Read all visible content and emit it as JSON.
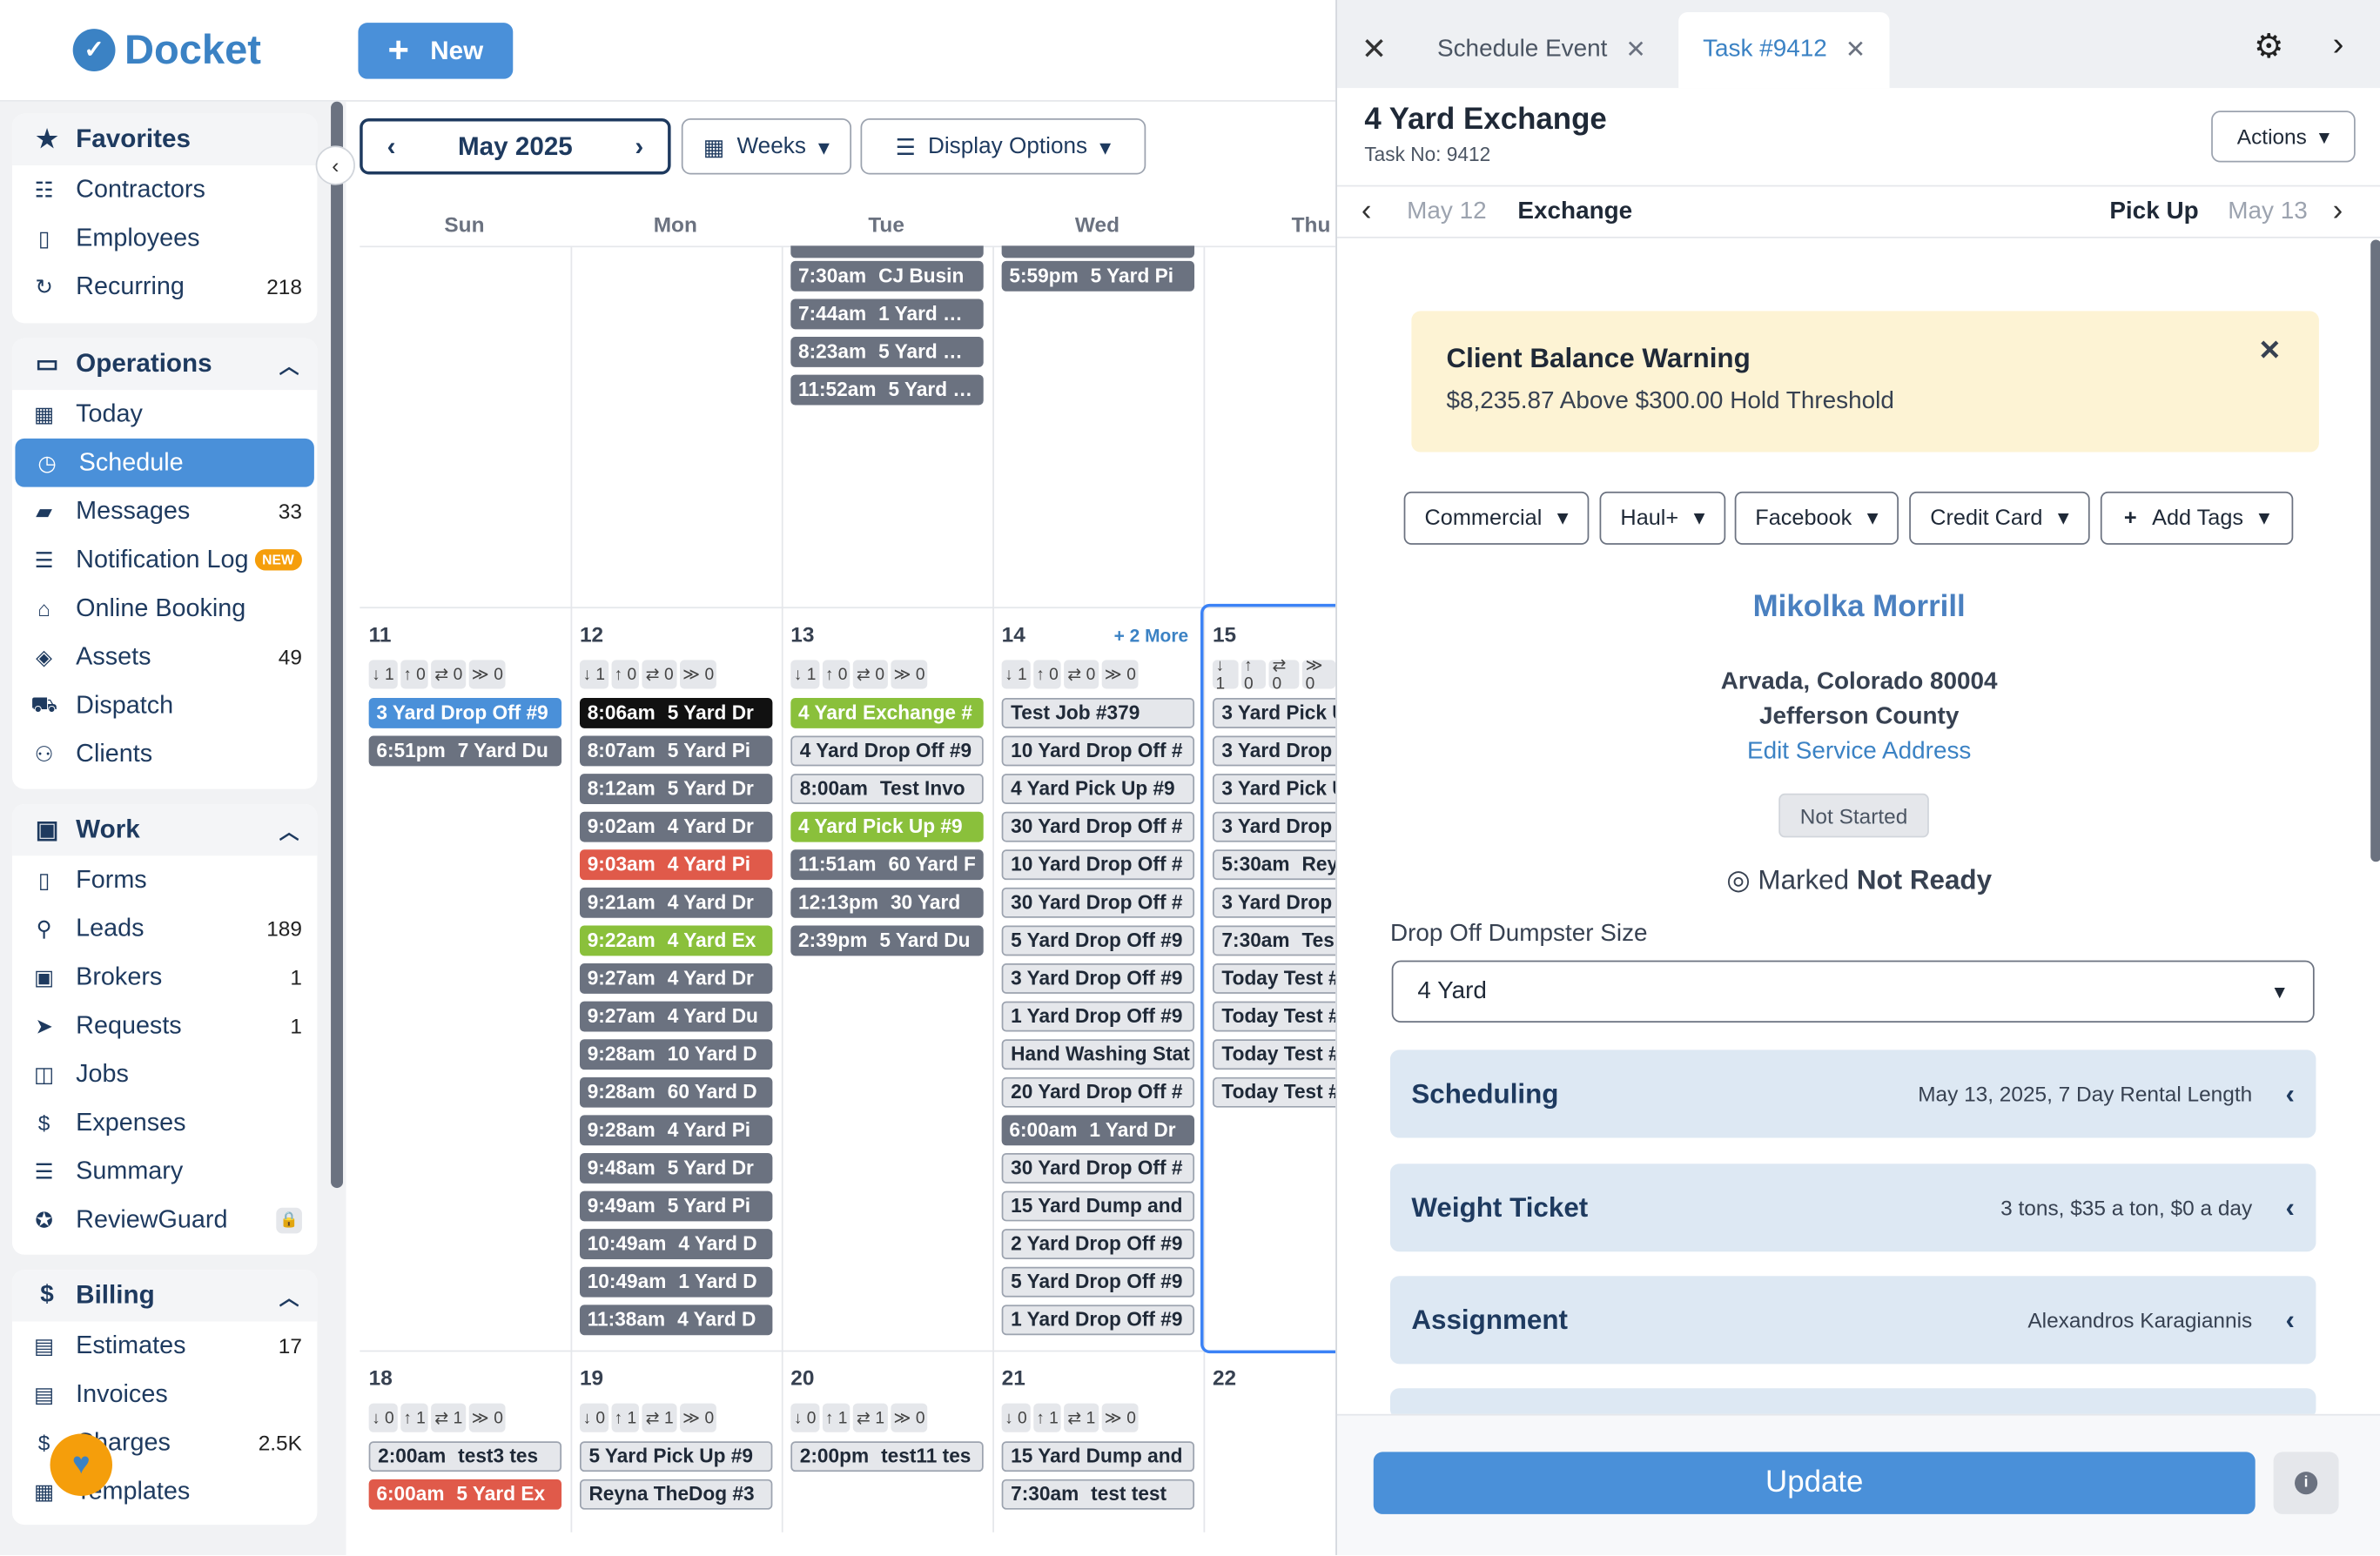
{
  "header": {
    "logo": "Docket",
    "new_label": "New"
  },
  "sidebar": {
    "favorites": {
      "title": "Favorites",
      "items": [
        {
          "label": "Contractors",
          "badge": ""
        },
        {
          "label": "Employees",
          "badge": ""
        },
        {
          "label": "Recurring",
          "badge": "218"
        }
      ]
    },
    "operations": {
      "title": "Operations",
      "items": [
        {
          "label": "Today",
          "badge": ""
        },
        {
          "label": "Schedule",
          "badge": ""
        },
        {
          "label": "Messages",
          "badge": "33"
        },
        {
          "label": "Notification Log",
          "badge": "NEW"
        },
        {
          "label": "Online Booking",
          "badge": ""
        },
        {
          "label": "Assets",
          "badge": "49"
        },
        {
          "label": "Dispatch",
          "badge": ""
        },
        {
          "label": "Clients",
          "badge": ""
        }
      ]
    },
    "work": {
      "title": "Work",
      "items": [
        {
          "label": "Forms",
          "badge": ""
        },
        {
          "label": "Leads",
          "badge": "189"
        },
        {
          "label": "Brokers",
          "badge": "1"
        },
        {
          "label": "Requests",
          "badge": "1"
        },
        {
          "label": "Jobs",
          "badge": ""
        },
        {
          "label": "Expenses",
          "badge": ""
        },
        {
          "label": "Summary",
          "badge": ""
        },
        {
          "label": "ReviewGuard",
          "badge": ""
        }
      ]
    },
    "billing": {
      "title": "Billing",
      "items": [
        {
          "label": "Estimates",
          "badge": "17"
        },
        {
          "label": "Invoices",
          "badge": ""
        },
        {
          "label": "Charges",
          "badge": "2.5K"
        },
        {
          "label": "Templates",
          "badge": ""
        }
      ]
    }
  },
  "calendar": {
    "month": "May 2025",
    "view": "Weeks",
    "display_options": "Display Options",
    "days": [
      "Sun",
      "Mon",
      "Tue",
      "Wed",
      "Thu"
    ],
    "week1": {
      "tue": [
        [
          "7:30am",
          "CJ Busin"
        ],
        [
          "7:44am",
          "1 Yard …"
        ],
        [
          "8:23am",
          "5 Yard …"
        ],
        [
          "11:52am",
          "5 Yard …"
        ]
      ],
      "wed": [
        [
          "5:59pm",
          "5 Yard Pi"
        ]
      ]
    },
    "week2": {
      "dates": [
        "11",
        "12",
        "13",
        "14",
        "15"
      ],
      "more": "+ 2 More",
      "sun": [
        [
          "",
          "3 Yard Drop Off #9"
        ],
        [
          "6:51pm",
          "7 Yard Du"
        ]
      ],
      "mon": [
        [
          "8:06am",
          "5 Yard Dr"
        ],
        [
          "8:07am",
          "5 Yard Pi"
        ],
        [
          "8:12am",
          "5 Yard Dr"
        ],
        [
          "9:02am",
          "4 Yard Dr"
        ],
        [
          "9:03am",
          "4 Yard Pi"
        ],
        [
          "9:21am",
          "4 Yard Dr"
        ],
        [
          "9:22am",
          "4 Yard Ex"
        ],
        [
          "9:27am",
          "4 Yard Dr"
        ],
        [
          "9:27am",
          "4 Yard Du"
        ],
        [
          "9:28am",
          "10 Yard D"
        ],
        [
          "9:28am",
          "60 Yard D"
        ],
        [
          "9:28am",
          "4 Yard Pi"
        ],
        [
          "9:48am",
          "5 Yard Dr"
        ],
        [
          "9:49am",
          "5 Yard Pi"
        ],
        [
          "10:49am",
          "4 Yard D"
        ],
        [
          "10:49am",
          "1 Yard D"
        ],
        [
          "11:38am",
          "4 Yard D"
        ]
      ],
      "tue": [
        [
          "",
          "4 Yard Exchange #"
        ],
        [
          "",
          "4 Yard Drop Off #9"
        ],
        [
          "8:00am",
          "Test Invo"
        ],
        [
          "",
          "4 Yard Pick Up #9"
        ],
        [
          "11:51am",
          "60 Yard F"
        ],
        [
          "12:13pm",
          "30 Yard"
        ],
        [
          "2:39pm",
          "5 Yard Du"
        ]
      ],
      "wed": [
        [
          "",
          "Test Job #379"
        ],
        [
          "",
          "10 Yard Drop Off #"
        ],
        [
          "",
          "4 Yard Pick Up #9"
        ],
        [
          "",
          "30 Yard Drop Off #"
        ],
        [
          "",
          "10 Yard Drop Off #"
        ],
        [
          "",
          "30 Yard Drop Off #"
        ],
        [
          "",
          "5 Yard Drop Off #9"
        ],
        [
          "",
          "3 Yard Drop Off #9"
        ],
        [
          "",
          "1 Yard Drop Off #9"
        ],
        [
          "",
          "Hand Washing Stat"
        ],
        [
          "",
          "20 Yard Drop Off #"
        ],
        [
          "6:00am",
          "1 Yard Dr"
        ],
        [
          "",
          "30 Yard Drop Off #"
        ],
        [
          "",
          "15 Yard Dump and"
        ],
        [
          "",
          "2 Yard Drop Off #9"
        ],
        [
          "",
          "5 Yard Drop Off #9"
        ],
        [
          "",
          "1 Yard Drop Off #9"
        ]
      ],
      "thu": [
        [
          "",
          "3 Yard Pick U"
        ],
        [
          "",
          "3 Yard Drop O"
        ],
        [
          "",
          "3 Yard Pick U"
        ],
        [
          "",
          "3 Yard Drop O"
        ],
        [
          "5:30am",
          "Rey"
        ],
        [
          "",
          "3 Yard Drop O"
        ],
        [
          "7:30am",
          "Tes"
        ],
        [
          "",
          "Today Test #"
        ],
        [
          "",
          "Today Test #"
        ],
        [
          "",
          "Today Test #"
        ],
        [
          "",
          "Today Test #"
        ]
      ]
    },
    "week3": {
      "dates": [
        "18",
        "19",
        "20",
        "21",
        "22"
      ],
      "sun": [
        [
          "2:00am",
          "test3 tes"
        ],
        [
          "6:00am",
          "5 Yard Ex"
        ]
      ],
      "mon": [
        [
          "",
          "5 Yard Pick Up #9"
        ],
        [
          "",
          "Reyna TheDog #3"
        ]
      ],
      "tue": [
        [
          "2:00pm",
          "test11 tes"
        ]
      ],
      "wed": [
        [
          "",
          "15 Yard Dump and"
        ],
        [
          "7:30am",
          "test test"
        ]
      ]
    }
  },
  "panel": {
    "tabs": [
      "Schedule Event",
      "Task #9412"
    ],
    "title": "4 Yard Exchange",
    "task_no": "Task No: 9412",
    "actions": "Actions",
    "nav": {
      "prev_date": "May 12",
      "current": "Exchange",
      "next_label": "Pick Up",
      "next_date": "May 13"
    },
    "warning": {
      "title": "Client Balance Warning",
      "text": "$8,235.87 Above $300.00 Hold Threshold"
    },
    "tags": [
      "Commercial",
      "Haul+",
      "Facebook",
      "Credit Card",
      "Add Tags"
    ],
    "client": "Mikolka Morrill",
    "address1": "Arvada, Colorado 80004",
    "address2": "Jefferson County",
    "edit_address": "Edit Service Address",
    "status": "Not Started",
    "marked_prefix": "Marked",
    "marked_value": "Not Ready",
    "dumpster_label": "Drop Off Dumpster Size",
    "dumpster_value": "4 Yard",
    "sections": [
      {
        "title": "Scheduling",
        "summary": "May 13, 2025, 7 Day Rental Length"
      },
      {
        "title": "Weight Ticket",
        "summary": "3 tons, $35 a ton, $0 a day"
      },
      {
        "title": "Assignment",
        "summary": "Alexandros Karagiannis"
      }
    ],
    "update": "Update"
  }
}
